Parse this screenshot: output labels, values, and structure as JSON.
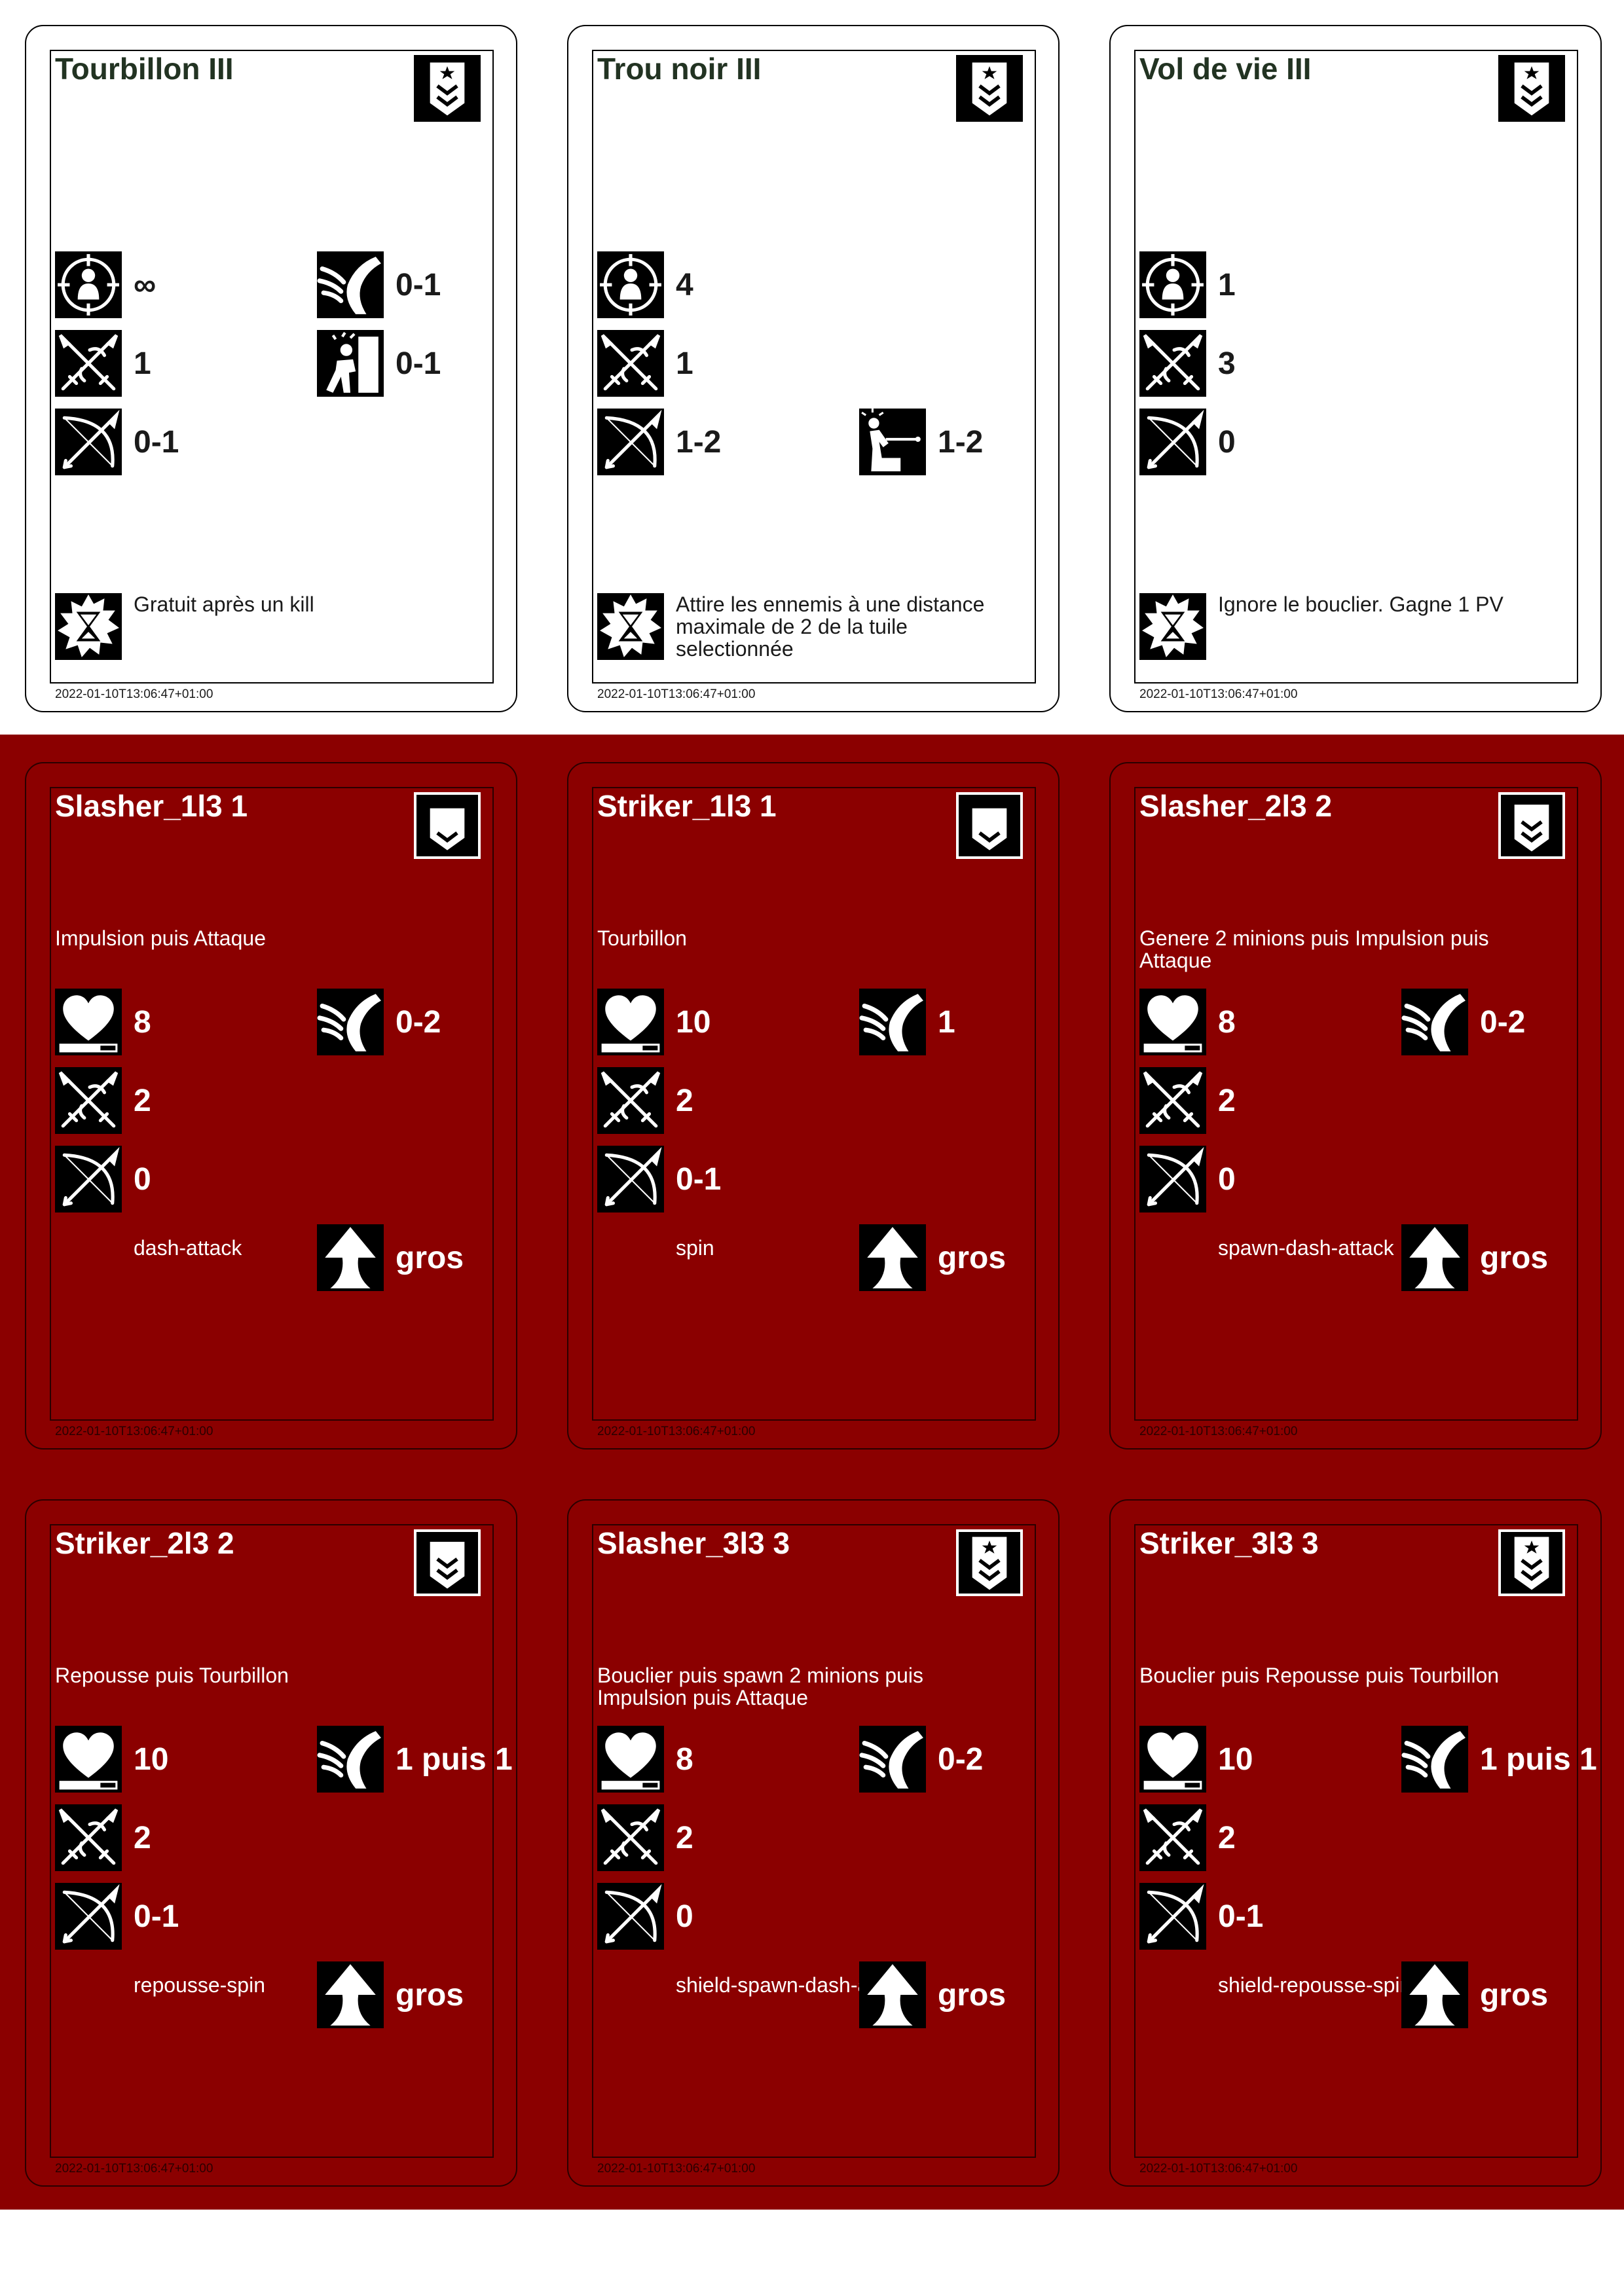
{
  "colors": {
    "red_background": "#8b0000",
    "white_card": "#ffffff",
    "icon_background": "#000000"
  },
  "timestamp": "2022-01-10T13:06:47+01:00",
  "skill_cards": [
    {
      "name": "Tourbillon III",
      "rank_icon": "rank-chevron-star-icon",
      "range": "∞",
      "melee": "1",
      "ranged": "0-1",
      "knockback": "0-1",
      "stun": "0-1",
      "pull": null,
      "ability_icon": "hourglass-burst-icon",
      "ability_text": "Gratuit après un kill"
    },
    {
      "name": "Trou noir III",
      "rank_icon": "rank-chevron-star-icon",
      "range": "4",
      "melee": "1",
      "ranged": "1-2",
      "knockback": null,
      "stun": null,
      "pull": "1-2",
      "ability_icon": "hourglass-burst-icon",
      "ability_text": "Attire les ennemis à une distance maximale de 2 de la tuile selectionnée"
    },
    {
      "name": "Vol de vie III",
      "rank_icon": "rank-chevron-star-icon",
      "range": "1",
      "melee": "3",
      "ranged": "0",
      "knockback": null,
      "stun": null,
      "pull": null,
      "ability_icon": "hourglass-burst-icon",
      "ability_text": "Ignore le bouclier. Gagne 1 PV"
    }
  ],
  "enemy_cards": [
    {
      "name": "Slasher_1l3 1",
      "rank": 1,
      "description": "Impulsion puis Attaque",
      "hp": "8",
      "knockback": "0-2",
      "melee": "2",
      "ranged": "0",
      "behavior": "dash-attack",
      "size": "gros"
    },
    {
      "name": "Striker_1l3 1",
      "rank": 1,
      "description": "Tourbillon",
      "hp": "10",
      "knockback": "1",
      "melee": "2",
      "ranged": "0-1",
      "behavior": "spin",
      "size": "gros"
    },
    {
      "name": "Slasher_2l3 2",
      "rank": 2,
      "description": "Genere 2 minions puis Impulsion puis Attaque",
      "hp": "8",
      "knockback": "0-2",
      "melee": "2",
      "ranged": "0",
      "behavior": "spawn-dash-attack",
      "size": "gros"
    },
    {
      "name": "Striker_2l3 2",
      "rank": 2,
      "description": "Repousse puis Tourbillon",
      "hp": "10",
      "knockback": "1 puis 1",
      "melee": "2",
      "ranged": "0-1",
      "behavior": "repousse-spin",
      "size": "gros"
    },
    {
      "name": "Slasher_3l3 3",
      "rank": 3,
      "description": "Bouclier puis spawn 2 minions puis Impulsion puis Attaque",
      "hp": "8",
      "knockback": "0-2",
      "melee": "2",
      "ranged": "0",
      "behavior": "shield-spawn-dash-attack",
      "size": "gros"
    },
    {
      "name": "Striker_3l3 3",
      "rank": 3,
      "description": "Bouclier puis Repousse puis Tourbillon",
      "hp": "10",
      "knockback": "1 puis 1",
      "melee": "2",
      "ranged": "0-1",
      "behavior": "shield-repousse-spin",
      "size": "gros"
    }
  ]
}
